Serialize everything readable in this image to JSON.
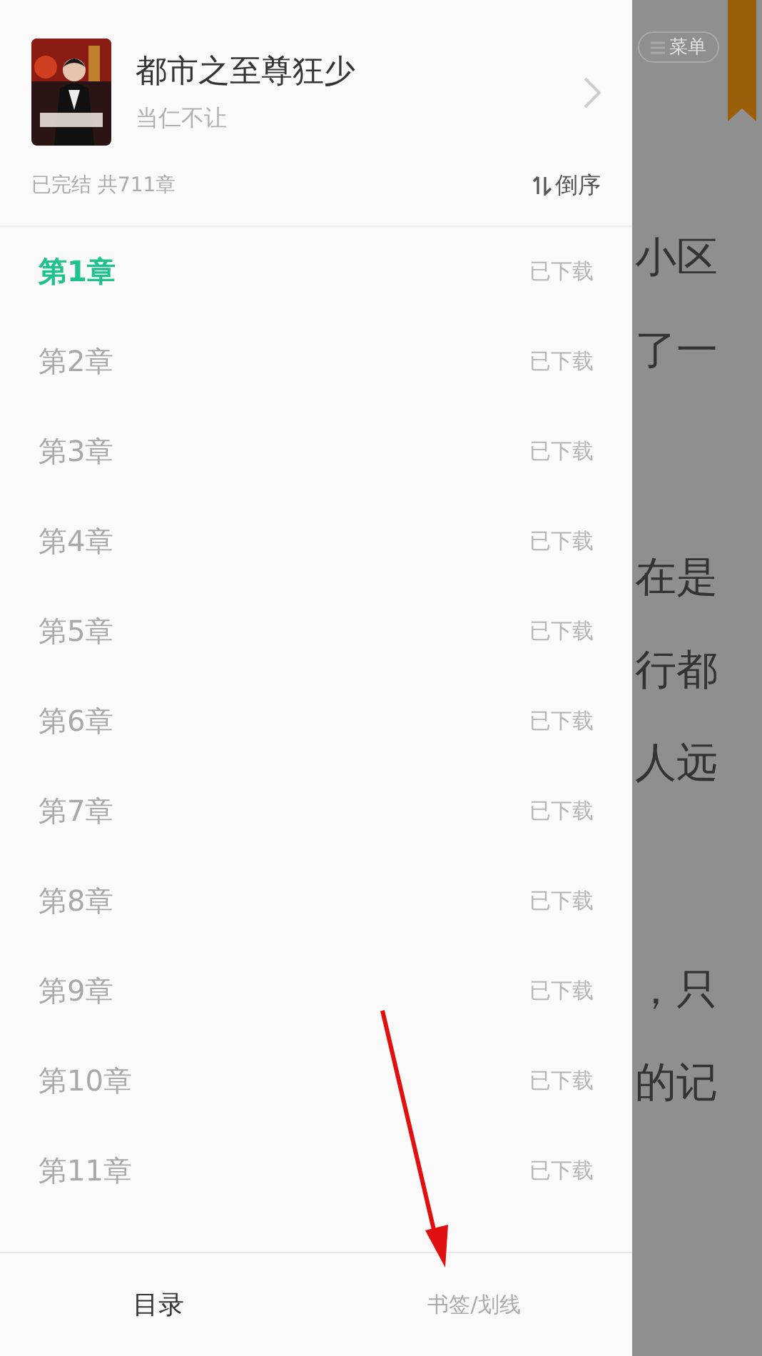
{
  "book": {
    "title": "都市之至尊狂少",
    "author": "当仁不让",
    "status": "已完结 共711章",
    "sort_label": "倒序"
  },
  "chapters": [
    {
      "title": "第1章",
      "status": "已下载",
      "selected": true
    },
    {
      "title": "第2章",
      "status": "已下载",
      "selected": false
    },
    {
      "title": "第3章",
      "status": "已下载",
      "selected": false
    },
    {
      "title": "第4章",
      "status": "已下载",
      "selected": false
    },
    {
      "title": "第5章",
      "status": "已下载",
      "selected": false
    },
    {
      "title": "第6章",
      "status": "已下载",
      "selected": false
    },
    {
      "title": "第7章",
      "status": "已下载",
      "selected": false
    },
    {
      "title": "第8章",
      "status": "已下载",
      "selected": false
    },
    {
      "title": "第9章",
      "status": "已下载",
      "selected": false
    },
    {
      "title": "第10章",
      "status": "已下载",
      "selected": false
    },
    {
      "title": "第11章",
      "status": "已下载",
      "selected": false
    }
  ],
  "tabs": [
    {
      "label": "目录",
      "selected": true
    },
    {
      "label": "书签/划线",
      "selected": false
    }
  ],
  "reader": {
    "menu_label": "菜单",
    "paragraphs": [
      [
        "小区",
        "了一"
      ],
      [
        "在是",
        "行都",
        "人远"
      ],
      [
        "，只",
        "的记"
      ]
    ]
  }
}
